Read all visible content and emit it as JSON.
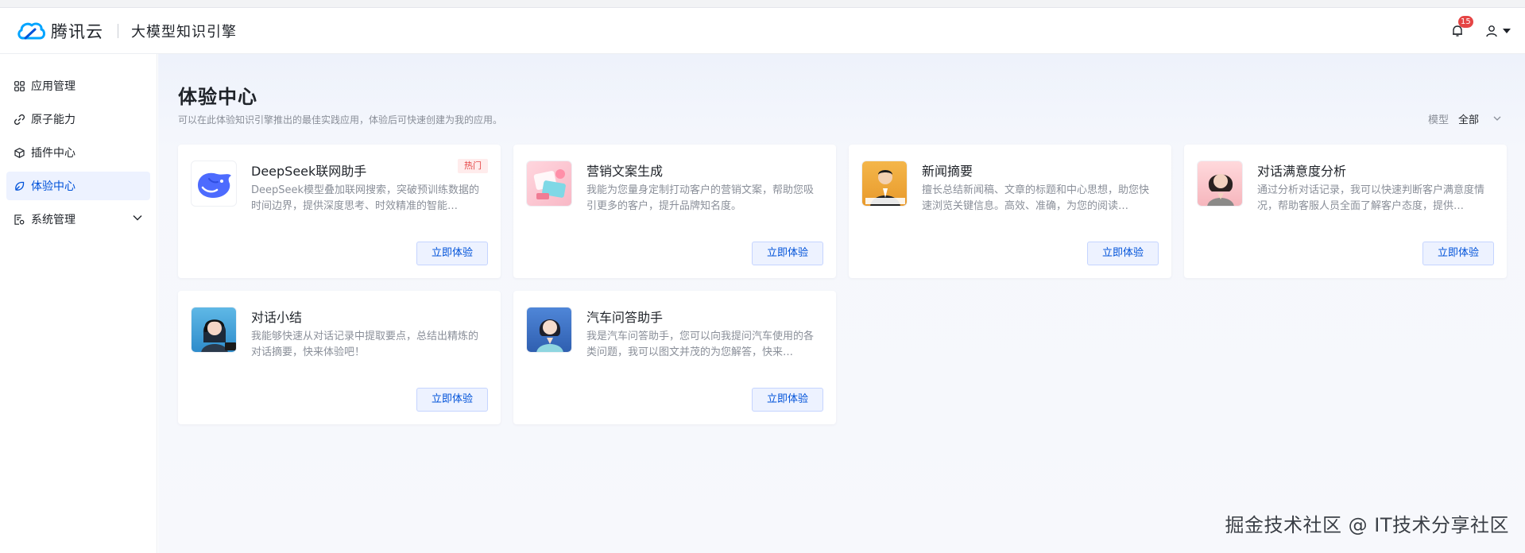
{
  "header": {
    "brand_name": "腾讯云",
    "product_name": "大模型知识引擎",
    "notification_count": "15"
  },
  "sidebar": {
    "items": [
      {
        "label": "应用管理",
        "icon": "grid-icon"
      },
      {
        "label": "原子能力",
        "icon": "link-icon"
      },
      {
        "label": "插件中心",
        "icon": "cube-icon"
      },
      {
        "label": "体验中心",
        "icon": "experience-icon",
        "active": true
      },
      {
        "label": "系统管理",
        "icon": "settings-doc-icon"
      }
    ]
  },
  "main": {
    "title": "体验中心",
    "subtitle": "可以在此体验知识引擎推出的最佳实践应用，体验后可快速创建为我的应用。",
    "filter_label": "模型",
    "filter_value": "全部"
  },
  "cards": [
    {
      "title": "DeepSeek联网助手",
      "tag": "热门",
      "desc": "DeepSeek模型叠加联网搜索，突破预训练数据的时间边界，提供深度思考、时效精准的智能…",
      "button": "立即体验"
    },
    {
      "title": "营销文案生成",
      "desc": "我能为您量身定制打动客户的营销文案，帮助您吸引更多的客户，提升品牌知名度。",
      "button": "立即体验"
    },
    {
      "title": "新闻摘要",
      "desc": "擅长总结新闻稿、文章的标题和中心思想，助您快速浏览关键信息。高效、准确，为您的阅读…",
      "button": "立即体验"
    },
    {
      "title": "对话满意度分析",
      "desc": "通过分析对话记录，我可以快速判断客户满意度情况，帮助客服人员全面了解客户态度，提供…",
      "button": "立即体验"
    },
    {
      "title": "对话小结",
      "desc": "我能够快速从对话记录中提取要点，总结出精炼的对话摘要，快来体验吧！",
      "button": "立即体验"
    },
    {
      "title": "汽车问答助手",
      "desc": "我是汽车问答助手，您可以向我提问汽车使用的各类问题，我可以图文并茂的为您解答，快来…",
      "button": "立即体验"
    }
  ],
  "watermark": "掘金技术社区 @ IT技术分享社区",
  "colors": {
    "accent": "#0052d9",
    "hot_tag": "#e54545",
    "active_bg": "#edf2ff"
  }
}
